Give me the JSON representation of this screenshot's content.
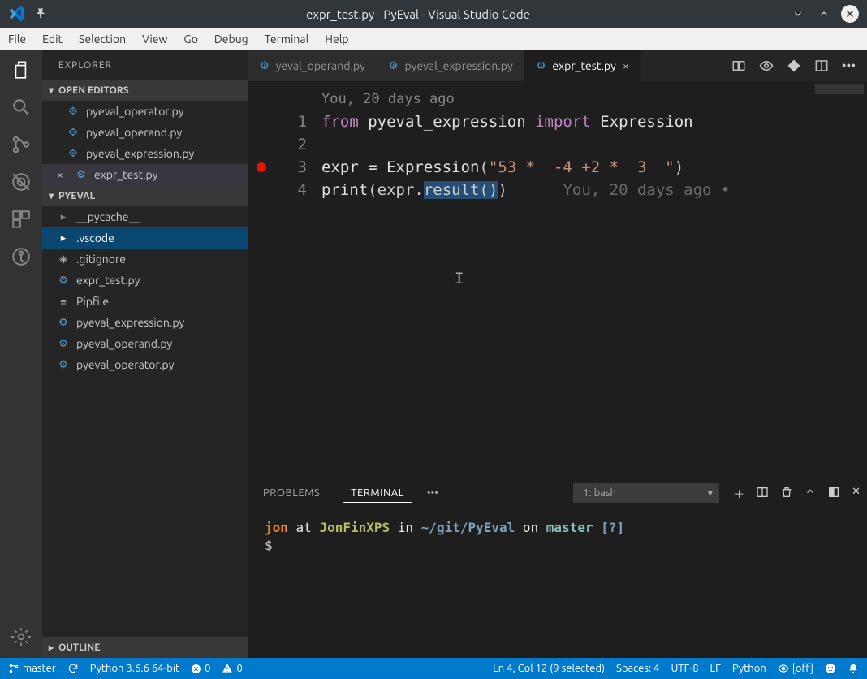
{
  "window": {
    "title": "expr_test.py - PyEval - Visual Studio Code"
  },
  "menu": [
    "File",
    "Edit",
    "Selection",
    "View",
    "Go",
    "Debug",
    "Terminal",
    "Help"
  ],
  "explorer": {
    "title": "EXPLORER",
    "sections": {
      "open_editors": {
        "label": "OPEN EDITORS",
        "items": [
          {
            "label": "pyeval_operator.py"
          },
          {
            "label": "pyeval_operand.py"
          },
          {
            "label": "pyeval_expression.py"
          },
          {
            "label": "expr_test.py",
            "active": true
          }
        ]
      },
      "workspace": {
        "label": "PYEVAL",
        "items": [
          {
            "label": "__pycache__",
            "type": "folder"
          },
          {
            "label": ".vscode",
            "type": "folder",
            "selected": true
          },
          {
            "label": ".gitignore",
            "type": "git"
          },
          {
            "label": "expr_test.py",
            "type": "py"
          },
          {
            "label": "Pipfile",
            "type": "txt"
          },
          {
            "label": "pyeval_expression.py",
            "type": "py"
          },
          {
            "label": "pyeval_operand.py",
            "type": "py"
          },
          {
            "label": "pyeval_operator.py",
            "type": "py"
          }
        ]
      },
      "outline": {
        "label": "OUTLINE"
      }
    }
  },
  "tabs": [
    {
      "label": "yeval_operand.py"
    },
    {
      "label": "pyeval_expression.py"
    },
    {
      "label": "expr_test.py",
      "active": true
    }
  ],
  "gitlens_top": "You, 20 days ago",
  "code": {
    "lines": [
      "1",
      "2",
      "3",
      "4"
    ],
    "l1_from": "from",
    "l1_mod": " pyeval_expression ",
    "l1_import": "import",
    "l1_name": " Expression",
    "l3a": "expr = ",
    "l3b": "Expression",
    "l3c": "(",
    "l3_str": "\"53 *  -4 +2 *  3  \"",
    "l3d": ")",
    "l4a": "print",
    "l4b": "(expr.",
    "l4_sel": "result()",
    "l4c": ")",
    "l4_blame": "You, 20 days ago •",
    "breakpoint_line": 4
  },
  "panel": {
    "tabs": {
      "problems": "PROBLEMS",
      "terminal": "TERMINAL"
    },
    "dropdown": "1: bash",
    "prompt": {
      "user": "jon",
      "at": " at ",
      "host": "JonFinXPS",
      "in": " in ",
      "path": "~/git/PyEval",
      "on": " on ",
      "branch": "master ",
      "flag": "[?]",
      "dollar": "$"
    }
  },
  "status": {
    "branch": "master",
    "python": "Python 3.6.6 64-bit",
    "errors": "0",
    "warnings": "0",
    "cursor": "Ln 4, Col 12 (9 selected)",
    "spaces": "Spaces: 4",
    "encoding": "UTF-8",
    "eol": "LF",
    "language": "Python",
    "live": "[off]"
  }
}
